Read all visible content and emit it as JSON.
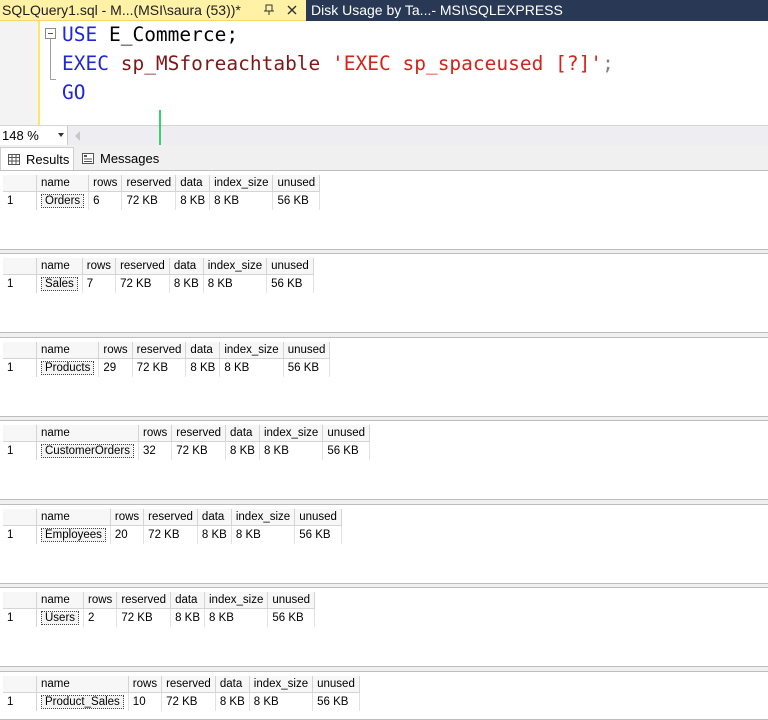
{
  "tabs": {
    "active_title": "SQLQuery1.sql - M...(MSI\\saura (53))*",
    "inactive_title": "Disk Usage by Ta...- MSI\\SQLEXPRESS"
  },
  "editor": {
    "line1": {
      "keyword": "USE",
      "rest": " E_Commerce;"
    },
    "line2": {
      "keyword": "EXEC",
      "proc": " sp_MSforeachtable ",
      "string": "'EXEC sp_spaceused [?]'",
      "end": ";"
    },
    "line3": {
      "keyword": "GO"
    }
  },
  "zoom": {
    "value": "148 %"
  },
  "result_tabs": {
    "results": "Results",
    "messages": "Messages"
  },
  "grid_headers": [
    "name",
    "rows",
    "reserved",
    "data",
    "index_size",
    "unused"
  ],
  "results": [
    {
      "row_num": "1",
      "name": "Orders",
      "rows": "6",
      "reserved": "72 KB",
      "data": "8 KB",
      "index_size": "8 KB",
      "unused": "56 KB"
    },
    {
      "row_num": "1",
      "name": "Sales",
      "rows": "7",
      "reserved": "72 KB",
      "data": "8 KB",
      "index_size": "8 KB",
      "unused": "56 KB"
    },
    {
      "row_num": "1",
      "name": "Products",
      "rows": "29",
      "reserved": "72 KB",
      "data": "8 KB",
      "index_size": "8 KB",
      "unused": "56 KB"
    },
    {
      "row_num": "1",
      "name": "CustomerOrders",
      "rows": "32",
      "reserved": "72 KB",
      "data": "8 KB",
      "index_size": "8 KB",
      "unused": "56 KB"
    },
    {
      "row_num": "1",
      "name": "Employees",
      "rows": "20",
      "reserved": "72 KB",
      "data": "8 KB",
      "index_size": "8 KB",
      "unused": "56 KB"
    },
    {
      "row_num": "1",
      "name": "Users",
      "rows": "2",
      "reserved": "72 KB",
      "data": "8 KB",
      "index_size": "8 KB",
      "unused": "56 KB"
    },
    {
      "row_num": "1",
      "name": "Product_Sales",
      "rows": "10",
      "reserved": "72 KB",
      "data": "8 KB",
      "index_size": "8 KB",
      "unused": "56 KB"
    }
  ],
  "colors": {
    "active_tab": "#fff1a6",
    "tab_strip": "#293955",
    "keyword": "#1f27d8",
    "string": "#d4231a",
    "annotation_arrow": "#35d070"
  }
}
